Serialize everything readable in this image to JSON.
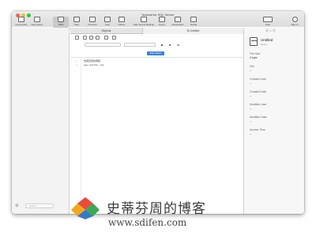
{
  "window": {
    "title": "Navicat for SQL Server"
  },
  "toolbar": {
    "items": [
      {
        "label": "Connection",
        "icon": "connection-icon"
      },
      {
        "label": "New Query",
        "icon": "new-query-icon"
      },
      {
        "label": "Table",
        "icon": "table-icon"
      },
      {
        "label": "View",
        "icon": "view-icon"
      },
      {
        "label": "Function",
        "icon": "function-icon"
      },
      {
        "label": "User",
        "icon": "user-icon"
      },
      {
        "label": "Others",
        "icon": "others-icon"
      },
      {
        "label": "SQL Server Backup",
        "icon": "backup-icon"
      },
      {
        "label": "Query",
        "icon": "query-icon"
      },
      {
        "label": "Automation",
        "icon": "automation-icon"
      },
      {
        "label": "Model",
        "icon": "model-icon"
      }
    ],
    "view_label": "View",
    "signin_label": "Sign In"
  },
  "tabs": {
    "objects": "Objects",
    "untitled": "Untitled"
  },
  "editor": {
    "sql_editor_label": "SQL Editor",
    "lines": [
      {
        "n": "1",
        "text": "史蒂芬周的博客"
      },
      {
        "n": "2",
        "text": "www.sdifen.com"
      }
    ]
  },
  "sidebar": {
    "search_placeholder": "Search"
  },
  "inspector": {
    "name": "Untitled",
    "type": "Query",
    "props": [
      {
        "label": "File Size",
        "value": "0 byte"
      },
      {
        "label": "File",
        "value": "--"
      },
      {
        "label": "Created User",
        "value": "--"
      },
      {
        "label": "Created Date",
        "value": "--"
      },
      {
        "label": "Modified User",
        "value": "--"
      },
      {
        "label": "Modified Date",
        "value": "--"
      },
      {
        "label": "Access Time",
        "value": "--"
      }
    ]
  },
  "watermark": {
    "name": "史蒂芬周的博客",
    "url": "www.sdifen.com"
  },
  "colors": {
    "accent": "#3b82d6",
    "close": "#fc5f57",
    "minimize": "#fdbc2e",
    "zoom": "#28c840"
  }
}
